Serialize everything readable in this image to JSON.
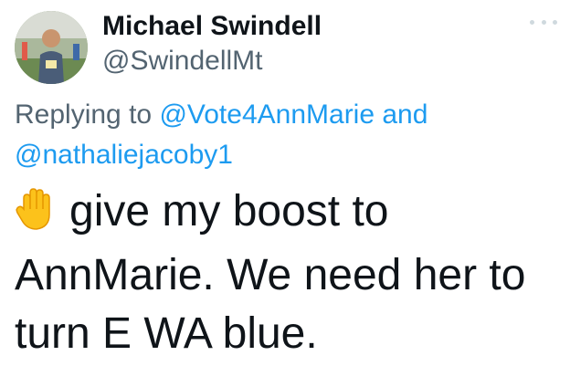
{
  "author": {
    "name": "Michael Swindell",
    "handle": "@SwindellMt",
    "avatar_alt": "profile-photo"
  },
  "reply_context": {
    "prefix": "Replying to",
    "mention_1": "@Vote4AnnMarie",
    "conjunction": "and",
    "mention_2": "@nathaliejacoby1"
  },
  "tweet": {
    "emoji": "raised-hand-emoji",
    "text": "give my boost to AnnMarie. We need her to turn E WA blue."
  },
  "colors": {
    "text_primary": "#0f1419",
    "text_secondary": "#536471",
    "link": "#1d9bf0"
  },
  "icons": {
    "more": "more-options-icon"
  }
}
